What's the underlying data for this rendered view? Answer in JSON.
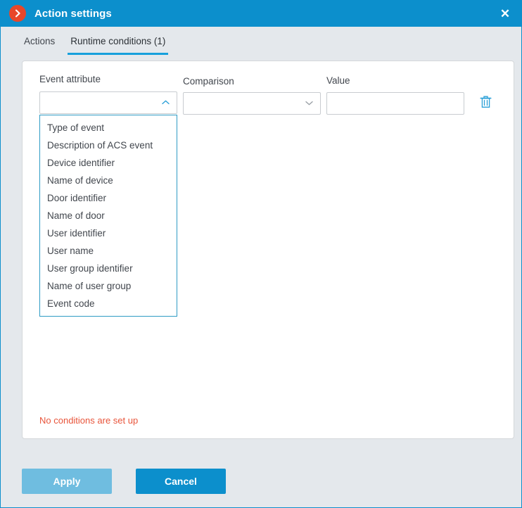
{
  "window": {
    "title": "Action settings",
    "app_icon": "chevron-right-circle-icon",
    "close_label": "✕",
    "accent_color": "#0c8fcc",
    "icon_color": "#e8472a",
    "background_color": "#e4e8ec"
  },
  "tabs": [
    {
      "label": "Actions",
      "active": false
    },
    {
      "label": "Runtime conditions (1)",
      "active": true
    }
  ],
  "form": {
    "event_attribute": {
      "label": "Event attribute",
      "value": "",
      "placeholder": "",
      "expanded": true,
      "chevron": "chevron-up-icon"
    },
    "comparison": {
      "label": "Comparison",
      "value": "",
      "placeholder": "",
      "expanded": false,
      "chevron": "chevron-down-icon"
    },
    "value_field": {
      "label": "Value",
      "value": "",
      "placeholder": ""
    },
    "delete_row": {
      "icon": "trash-icon",
      "color": "#2ba0d8"
    }
  },
  "dropdown_options": [
    "Type of event",
    "Description of ACS event",
    "Device identifier",
    "Name of device",
    "Door identifier",
    "Name of door",
    "User identifier",
    "User name",
    "User group identifier",
    "Name of user group",
    "Event code"
  ],
  "status": {
    "message": "No conditions are set up",
    "color": "#e8543a"
  },
  "footer": {
    "apply_label": "Apply",
    "cancel_label": "Cancel",
    "apply_color": "#6fbde0",
    "cancel_color": "#0c8fcc"
  }
}
